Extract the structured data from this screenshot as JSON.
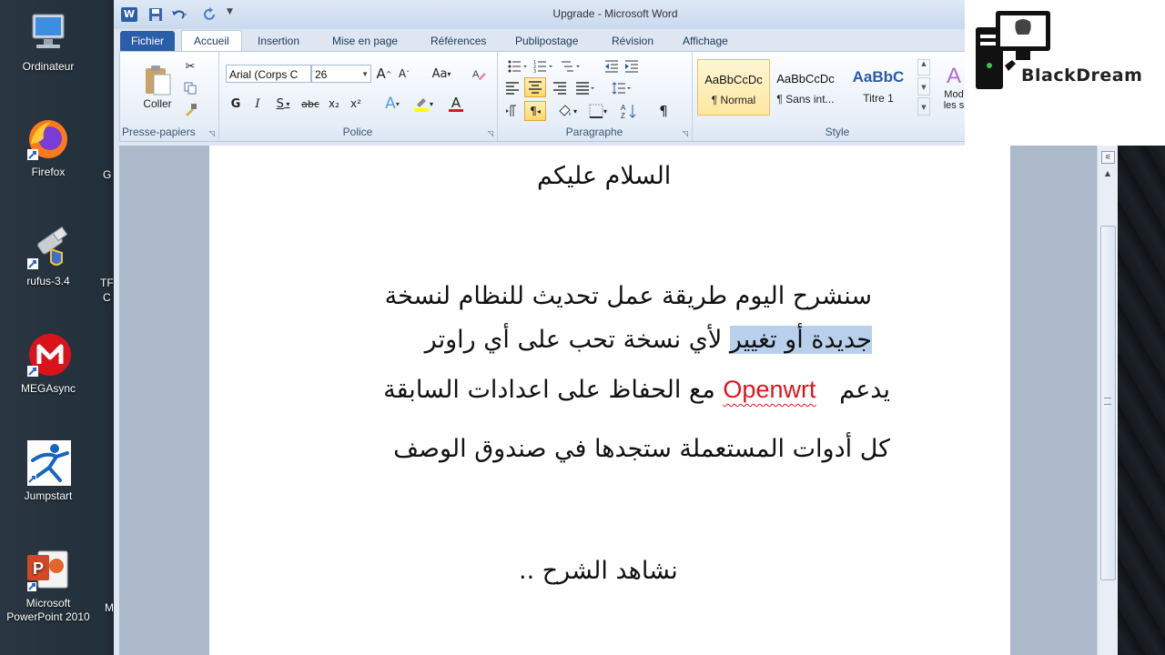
{
  "desktop": {
    "icons": [
      {
        "label": "Ordinateur"
      },
      {
        "label": "Firefox"
      },
      {
        "label": "rufus-3.4"
      },
      {
        "label": "MEGAsync"
      },
      {
        "label": "Jumpstart"
      },
      {
        "label": "Microsoft PowerPoint 2010"
      }
    ],
    "partial_labels": [
      "G",
      "TF",
      "C",
      "M"
    ]
  },
  "window": {
    "title": "Upgrade  -  Microsoft Word"
  },
  "tabs": [
    {
      "label": "Fichier"
    },
    {
      "label": "Accueil"
    },
    {
      "label": "Insertion"
    },
    {
      "label": "Mise en page"
    },
    {
      "label": "Références"
    },
    {
      "label": "Publipostage"
    },
    {
      "label": "Révision"
    },
    {
      "label": "Affichage"
    }
  ],
  "ribbon": {
    "clipboard": {
      "label": "Presse-papiers",
      "paste_label": "Coller"
    },
    "font": {
      "label": "Police",
      "font_name": "Arial (Corps C",
      "font_size": "26",
      "bold": "G",
      "italic": "I",
      "underline": "S",
      "strike": "abc",
      "subscript": "x₂",
      "superscript": "x²",
      "grow": "A",
      "shrink": "A",
      "case": "Aa",
      "text_effect": "A",
      "font_color": "A"
    },
    "paragraph": {
      "label": "Paragraphe",
      "pilcrow": "¶"
    },
    "styles": {
      "label": "Style",
      "items": [
        {
          "sample": "AaBbCcDc",
          "name": "¶ Normal"
        },
        {
          "sample": "AaBbCcDc",
          "name": "¶ Sans int..."
        },
        {
          "sample": "AaBbC",
          "name": "Titre 1"
        }
      ],
      "change_styles_1": "Mod",
      "change_styles_2": "les s"
    }
  },
  "document": {
    "line1": "السلام عليكم",
    "line2": "سنشرح اليوم طريقة عمل تحديث للنظام لنسخة",
    "line3_selected": "جديدة أو تغيير",
    "line3_rest": "لأي نسخة تحب على أي راوتر",
    "line4_pre": "يدعم",
    "line4_brand": "Openwrt",
    "line4_post": "مع الحفاظ على اعدادات السابقة",
    "line5": "كل أدوات المستعملة ستجدها في صندوق الوصف",
    "line6": "نشاهد الشرح .."
  },
  "logo": {
    "text": "BlackDream"
  }
}
